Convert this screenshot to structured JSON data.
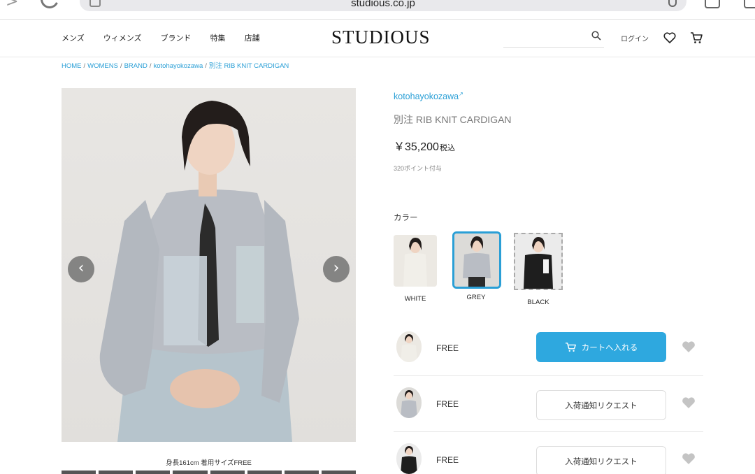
{
  "browser": {
    "url": "studious.co.jp"
  },
  "header": {
    "nav": [
      "メンズ",
      "ウィメンズ",
      "ブランド",
      "特集",
      "店舗"
    ],
    "logo": "STUDIOUS",
    "search_placeholder": "",
    "login": "ログイン"
  },
  "breadcrumb": [
    "HOME",
    "WOMENS",
    "BRAND",
    "kotohayokozawa",
    "別注 RIB KNIT CARDIGAN"
  ],
  "gallery": {
    "caption": "身長161cm 着用サイズFREE",
    "prev_icon": "‹",
    "next_icon": "›"
  },
  "product": {
    "brand": "kotohayokozawa",
    "name": "別注 RIB KNIT CARDIGAN",
    "price": "￥35,200",
    "tax_label": "税込",
    "points": "320ポイント付与",
    "color_label": "カラー",
    "colors": [
      {
        "label": "WHITE",
        "selected": false
      },
      {
        "label": "GREY",
        "selected": true
      },
      {
        "label": "BLACK",
        "selected": false
      }
    ],
    "sizes": [
      {
        "size": "FREE",
        "action": "カートへ入れる",
        "type": "cart"
      },
      {
        "size": "FREE",
        "action": "入荷通知リクエスト",
        "type": "notify"
      },
      {
        "size": "FREE",
        "action": "入荷通知リクエスト",
        "type": "notify"
      }
    ]
  },
  "colors": {
    "accent": "#2ea8df",
    "link": "#2a9fd6"
  }
}
